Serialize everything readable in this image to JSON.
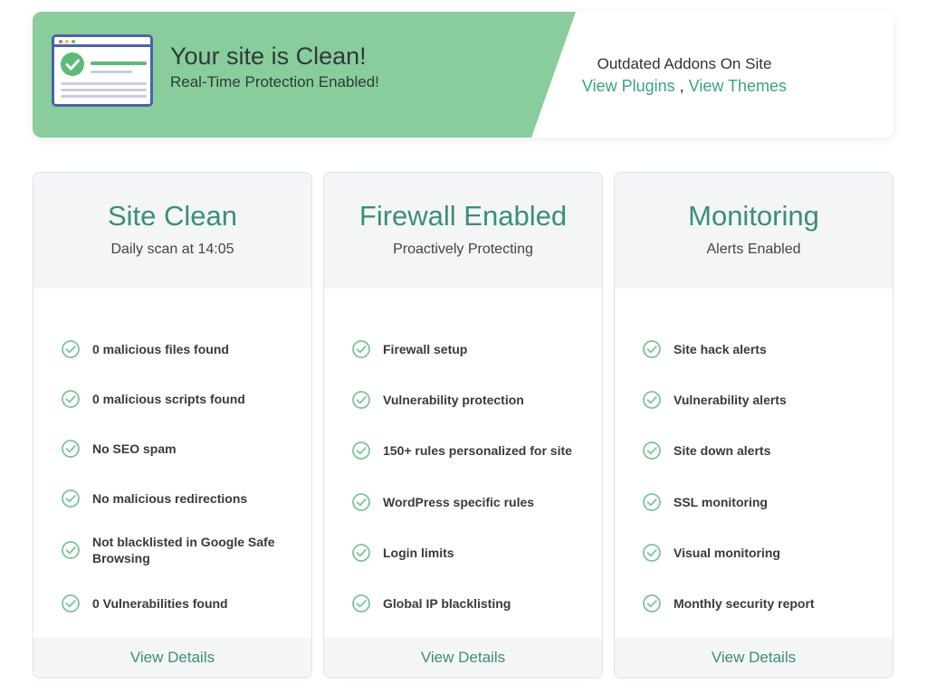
{
  "banner": {
    "title": "Your site is Clean!",
    "subtitle": "Real-Time Protection Enabled!",
    "addons_title": "Outdated Addons On Site",
    "link_plugins": "View Plugins",
    "link_separator": " , ",
    "link_themes": "View Themes"
  },
  "cards": [
    {
      "title": "Site Clean",
      "subtitle": "Daily scan at 14:05",
      "items": [
        "0 malicious files found",
        "0 malicious scripts found",
        "No SEO spam",
        "No malicious redirections",
        "Not blacklisted in Google Safe Browsing",
        "0 Vulnerabilities found"
      ],
      "footer": "View Details"
    },
    {
      "title": "Firewall Enabled",
      "subtitle": "Proactively Protecting",
      "items": [
        "Firewall setup",
        "Vulnerability protection",
        "150+ rules personalized for site",
        "WordPress specific rules",
        "Login limits",
        "Global IP blacklisting"
      ],
      "footer": "View Details"
    },
    {
      "title": "Monitoring",
      "subtitle": "Alerts Enabled",
      "items": [
        "Site hack alerts",
        "Vulnerability alerts",
        "Site down alerts",
        "SSL monitoring",
        "Visual monitoring",
        "Monthly security report"
      ],
      "footer": "View Details"
    }
  ],
  "colors": {
    "accent": "#3a8f79",
    "banner_green": "#88cd9b",
    "link": "#3aa47d",
    "check": "#7cc49a",
    "illustration_border": "#4a63b0"
  },
  "icons": {
    "item": "check-circle-icon",
    "banner": "browser-check-icon"
  }
}
